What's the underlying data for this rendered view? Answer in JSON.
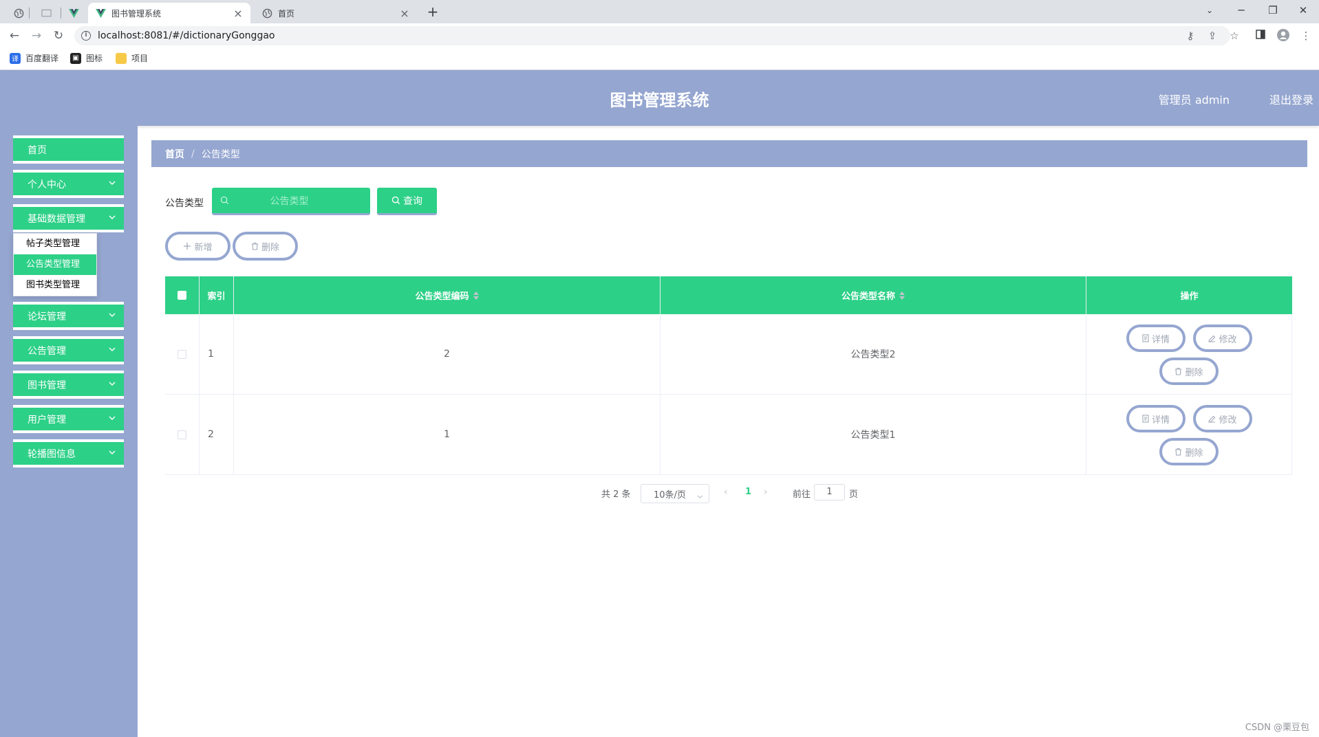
{
  "browser": {
    "tabs": [
      {
        "title": "图书管理系统"
      },
      {
        "title": "首页"
      }
    ],
    "url": "localhost:8081/#/dictionaryGonggao",
    "bookmarks": [
      "百度翻译",
      "图标",
      "项目"
    ],
    "win_minimize": "─",
    "win_restore": "❐",
    "win_close": "✕"
  },
  "header": {
    "title": "图书管理系统",
    "user": "管理员 admin",
    "logout": "退出登录"
  },
  "sidebar": {
    "items": [
      {
        "label": "首页"
      },
      {
        "label": "个人中心"
      },
      {
        "label": "基础数据管理"
      },
      {
        "label": "论坛管理"
      },
      {
        "label": "公告管理"
      },
      {
        "label": "图书管理"
      },
      {
        "label": "用户管理"
      },
      {
        "label": "轮播图信息"
      }
    ],
    "submenu": [
      {
        "label": "帖子类型管理"
      },
      {
        "label": "公告类型管理"
      },
      {
        "label": "图书类型管理"
      }
    ]
  },
  "breadcrumb": {
    "home": "首页",
    "current": "公告类型"
  },
  "search": {
    "label": "公告类型",
    "placeholder": "公告类型",
    "query_label": "查询"
  },
  "actions": {
    "add_label": "新增",
    "delete_label": "删除"
  },
  "table": {
    "headers": {
      "index": "索引",
      "code": "公告类型编码",
      "name": "公告类型名称",
      "ops": "操作"
    },
    "rows": [
      {
        "index": "1",
        "code": "2",
        "name": "公告类型2"
      },
      {
        "index": "2",
        "code": "1",
        "name": "公告类型1"
      }
    ],
    "op_labels": {
      "detail": "详情",
      "edit": "修改",
      "delete": "删除"
    }
  },
  "pagination": {
    "total": "共 2 条",
    "page_size": "10条/页",
    "current_page": "1",
    "goto": "前往",
    "jump_value": "1",
    "page_suffix": "页",
    "prev": "‹",
    "next": "›"
  },
  "watermark": "CSDN @栗豆包",
  "colors": {
    "accent_green": "#2dd087",
    "header_blue": "#95a6d0"
  }
}
